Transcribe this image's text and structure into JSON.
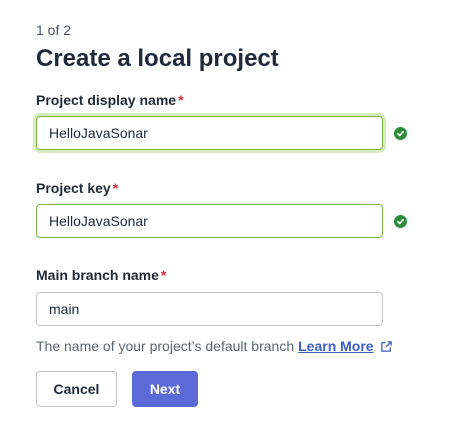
{
  "form": {
    "step": "1 of 2",
    "title": "Create a local project",
    "required_mark": "*",
    "display_name": {
      "label": "Project display name",
      "value": "HelloJavaSonar",
      "status": "valid"
    },
    "project_key": {
      "label": "Project key",
      "value": "HelloJavaSonar",
      "status": "valid"
    },
    "main_branch": {
      "label": "Main branch name",
      "value": "main",
      "helper": "The name of your project’s default branch",
      "learn_more": "Learn More"
    },
    "cancel_label": "Cancel",
    "next_label": "Next"
  },
  "colors": {
    "valid_border": "#7ab648",
    "check_green": "#2e8b3a",
    "primary": "#5a6ad6",
    "required": "#d02f3a",
    "link": "#3b5fc0"
  },
  "icons": {
    "valid": "check-circle-icon",
    "external": "external-link-icon"
  }
}
